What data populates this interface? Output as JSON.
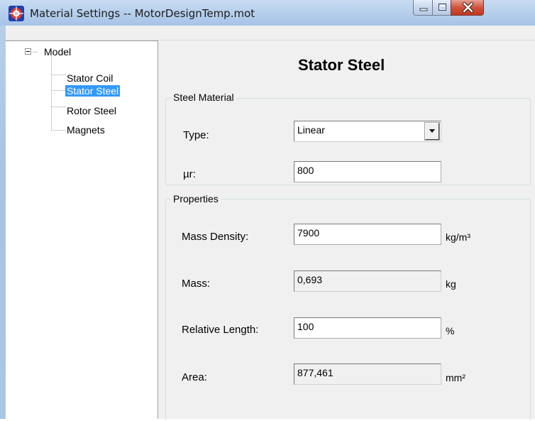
{
  "window": {
    "title": "Material Settings -- MotorDesignTemp.mot",
    "icon": "motor-app-icon",
    "controls": {
      "minimize": "minimize-icon",
      "maximize": "maximize-icon",
      "close": "close-icon"
    }
  },
  "tree": {
    "root": {
      "label": "Model",
      "expanded": true,
      "toggle": "⊟"
    },
    "items": [
      {
        "label": "Stator Coil",
        "selected": false
      },
      {
        "label": "Stator Steel",
        "selected": true
      },
      {
        "label": "Rotor Steel",
        "selected": false
      },
      {
        "label": "Magnets",
        "selected": false
      }
    ]
  },
  "panel": {
    "title": "Stator Steel",
    "steel_material": {
      "legend": "Steel Material",
      "type_label": "Type:",
      "type_value": "Linear",
      "mur_label": "µr:",
      "mur_value": "800"
    },
    "properties": {
      "legend": "Properties",
      "mass_density": {
        "label": "Mass Density:",
        "value": "7900",
        "unit": "kg/m³"
      },
      "mass": {
        "label": "Mass:",
        "value": "0,693",
        "unit": "kg"
      },
      "relative_length": {
        "label": "Relative Length:",
        "value": "100",
        "unit": "%"
      },
      "area": {
        "label": "Area:",
        "value": "877,461",
        "unit": "mm²"
      }
    }
  },
  "colors": {
    "selection": "#3399ff",
    "close_button": "#c3391f",
    "frame": "#b9d1ea"
  }
}
